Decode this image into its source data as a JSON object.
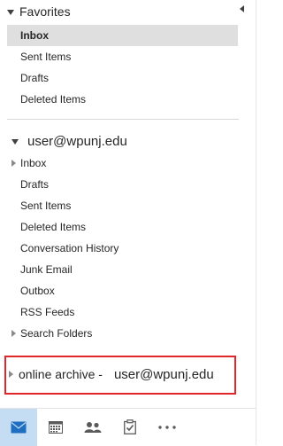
{
  "favorites": {
    "title": "Favorites",
    "items": [
      {
        "label": "Inbox",
        "selected": true
      },
      {
        "label": "Sent Items"
      },
      {
        "label": "Drafts"
      },
      {
        "label": "Deleted Items"
      }
    ]
  },
  "account": {
    "email": "user@wpunj.edu",
    "folders": [
      {
        "label": "Inbox",
        "expandable": true
      },
      {
        "label": "Drafts"
      },
      {
        "label": "Sent Items"
      },
      {
        "label": "Deleted Items"
      },
      {
        "label": "Conversation History"
      },
      {
        "label": "Junk Email"
      },
      {
        "label": "Outbox"
      },
      {
        "label": "RSS Feeds"
      },
      {
        "label": "Search Folders",
        "expandable": true
      }
    ]
  },
  "archive": {
    "label": "online archive -",
    "email": "user@wpunj.edu",
    "highlight_color": "#e0282c"
  },
  "nav": {
    "active_color": "#c5ddf3",
    "icon_color": "#1e6fc2",
    "items": [
      {
        "icon": "mail-icon",
        "active": true
      },
      {
        "icon": "calendar-icon"
      },
      {
        "icon": "people-icon"
      },
      {
        "icon": "tasks-icon"
      },
      {
        "icon": "more-icon"
      }
    ]
  }
}
